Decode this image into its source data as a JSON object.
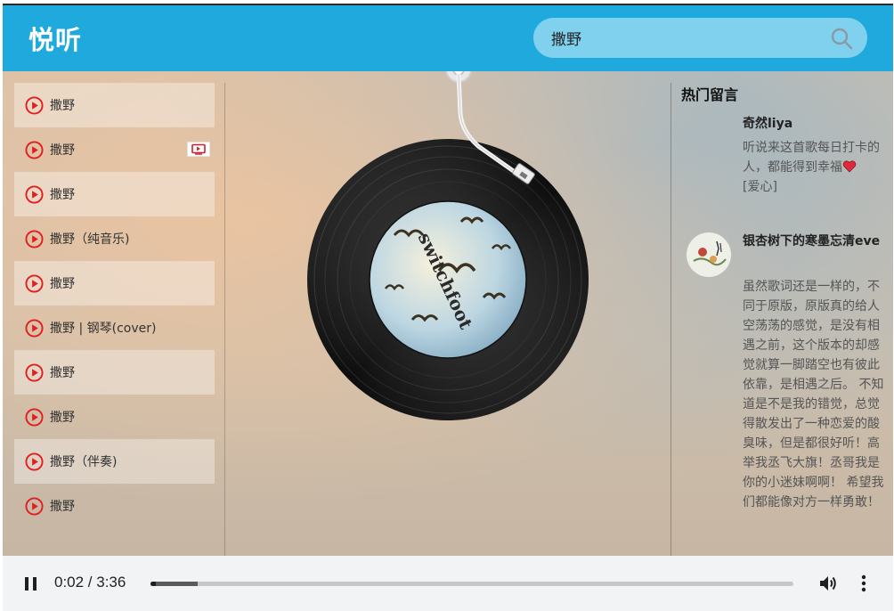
{
  "header": {
    "title": "悦听"
  },
  "search": {
    "value": "撒野",
    "placeholder": ""
  },
  "playlist": {
    "items": [
      {
        "title": "撒野",
        "has_mv": false
      },
      {
        "title": "撒野",
        "has_mv": true
      },
      {
        "title": "撒野",
        "has_mv": false
      },
      {
        "title": "撒野（纯音乐)",
        "has_mv": false
      },
      {
        "title": "撒野",
        "has_mv": false
      },
      {
        "title": "撒野 | 钢琴(cover)",
        "has_mv": false
      },
      {
        "title": "撒野",
        "has_mv": false
      },
      {
        "title": "撒野",
        "has_mv": false
      },
      {
        "title": "撒野（伴奏)",
        "has_mv": false
      },
      {
        "title": "撒野",
        "has_mv": false
      }
    ]
  },
  "album": {
    "cover_text": "switchfoot"
  },
  "comments": {
    "title": "热门留言",
    "items": [
      {
        "user": "奇然liya",
        "text": "听说来这首歌每日打卡的人，都能得到幸福",
        "text_after": "[爱心]",
        "has_avatar": false
      },
      {
        "user": "银杏树下的寒墨忘清eve",
        "text": "虽然歌词还是一样的，不同于原版，原版真的给人空荡荡的感觉，是没有相遇之前，这个版本的却感觉就算一脚踏空也有彼此依靠，是相遇之后。 不知道是不是我的错觉，总觉得散发出了一种恋爱的酸臭味，但是都很好听！高举我丞飞大旗！丞哥我是你的小迷妹啊啊！ 希望我们都能像对方一样勇敢！",
        "has_avatar": true
      }
    ]
  },
  "player": {
    "current_time": "0:02",
    "duration": "3:36",
    "time_label": "0:02 / 3:36",
    "progress": 0.009,
    "buffered": 0.074
  },
  "colors": {
    "header": "#1fa9dc",
    "search_bg": "#7fd1ee",
    "play_icon": "#e02020",
    "player_bg": "#f1f3f4"
  }
}
